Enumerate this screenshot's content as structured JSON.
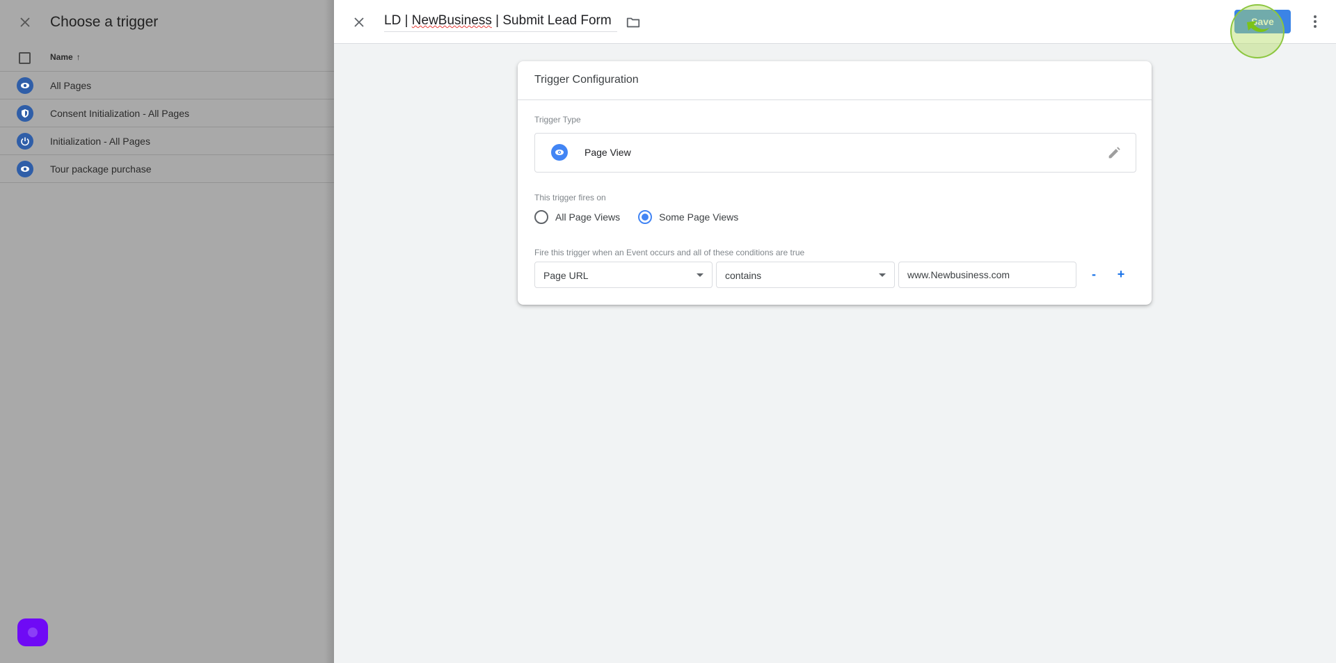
{
  "left_sheet": {
    "title": "Choose a trigger",
    "column_header": "Name",
    "sort_indicator": "↑",
    "rows": [
      {
        "label": "All Pages",
        "icon": "eye-icon"
      },
      {
        "label": "Consent Initialization - All Pages",
        "icon": "shield-icon"
      },
      {
        "label": "Initialization - All Pages",
        "icon": "power-icon"
      },
      {
        "label": "Tour package purchase",
        "icon": "eye-icon"
      }
    ]
  },
  "header": {
    "trigger_name": "LD | NewBusiness | Submit Lead Form",
    "trigger_name_parts": [
      "LD | ",
      "NewBusiness",
      " | Submit Lead Form"
    ],
    "save_label": "Save"
  },
  "card": {
    "title": "Trigger Configuration",
    "trigger_type_label": "Trigger Type",
    "trigger_type_value": "Page View",
    "fires_on_label": "This trigger fires on",
    "radio_options": [
      {
        "label": "All Page Views",
        "checked": false
      },
      {
        "label": "Some Page Views",
        "checked": true
      }
    ],
    "conditions_label": "Fire this trigger when an Event occurs and all of these conditions are true",
    "condition": {
      "variable": "Page URL",
      "operator": "contains",
      "value": "www.Newbusiness.com"
    },
    "remove_label": "-",
    "add_label": "+"
  },
  "colors": {
    "accent": "#4285f4",
    "save_button": "#3b84e6",
    "fab": "#6f0af5",
    "overlay": "#a9a9a9"
  }
}
